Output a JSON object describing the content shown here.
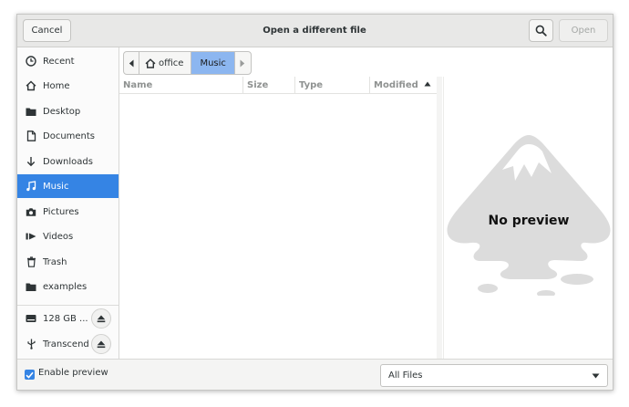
{
  "header": {
    "cancel_label": "Cancel",
    "title": "Open a different file",
    "open_label": "Open"
  },
  "pathbar": {
    "segments": [
      "office",
      "Music"
    ]
  },
  "sidebar": {
    "items": [
      {
        "label": "Recent",
        "icon": "clock-icon"
      },
      {
        "label": "Home",
        "icon": "home-icon"
      },
      {
        "label": "Desktop",
        "icon": "folder-icon"
      },
      {
        "label": "Documents",
        "icon": "document-icon"
      },
      {
        "label": "Downloads",
        "icon": "download-icon"
      },
      {
        "label": "Music",
        "icon": "music-note-icon",
        "active": true
      },
      {
        "label": "Pictures",
        "icon": "camera-icon"
      },
      {
        "label": "Videos",
        "icon": "video-icon"
      },
      {
        "label": "Trash",
        "icon": "trash-icon"
      },
      {
        "label": "examples",
        "icon": "folder-icon"
      }
    ],
    "devices": [
      {
        "label": "128 GB ...",
        "icon": "drive-icon"
      },
      {
        "label": "Transcend",
        "icon": "usb-icon"
      }
    ]
  },
  "columns": [
    "Name",
    "Size",
    "Type",
    "Modified"
  ],
  "preview": {
    "text": "No preview"
  },
  "footer": {
    "enable_preview_label": "Enable preview",
    "enable_preview_checked": true,
    "filter_value": "All Files"
  },
  "colors": {
    "accent": "#3584e4",
    "header_bg": "#e8e8e7",
    "preview_art": "#dcdcdc"
  }
}
